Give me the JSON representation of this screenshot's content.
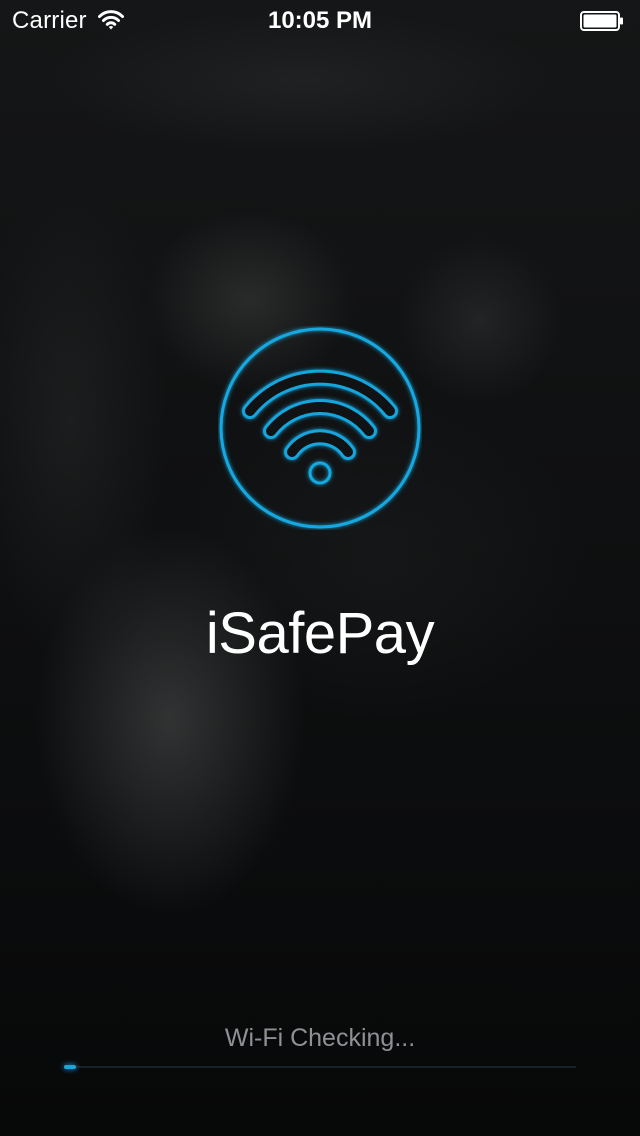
{
  "status_bar": {
    "carrier": "Carrier",
    "time": "10:05 PM",
    "wifi_icon": "wifi-icon",
    "battery_icon": "battery-icon",
    "battery_level": 1.0
  },
  "splash": {
    "logo_icon": "wifi-circle-icon",
    "title": "iSafePay",
    "status": "Wi-Fi Checking...",
    "progress": 0.02
  },
  "colors": {
    "accent": "#18a8e0",
    "background": "#0b0c0d",
    "status_text": "#8e9095",
    "title_text": "#ffffff"
  }
}
